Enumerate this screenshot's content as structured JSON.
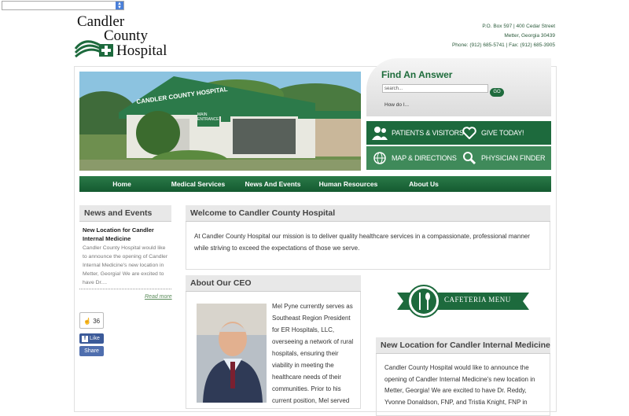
{
  "logo": {
    "line1": "Candler",
    "line2": "County",
    "line3": "Hospital"
  },
  "contact": {
    "address": "P.O. Box 597 | 400 Cedar Street",
    "city": "Metter, Georgia 30439",
    "phone": "Phone: (912) 685-5741 | Fax: (912) 685-3905"
  },
  "hero": {
    "sign_text": "CANDLER COUNTY HOSPITAL",
    "entrance_label": "MAIN ENTRANCE"
  },
  "find_answer": {
    "title": "Find An Answer",
    "search_value": "search...",
    "go_label": "GO",
    "howdo_label": "How do I..."
  },
  "quick_links": [
    {
      "label": "PATIENTS & VISITORS",
      "icon": "people-icon"
    },
    {
      "label": "GIVE TODAY!",
      "icon": "heart-icon"
    },
    {
      "label": "MAP & DIRECTIONS",
      "icon": "globe-icon"
    },
    {
      "label": "PHYSICIAN FINDER",
      "icon": "magnifier-icon"
    }
  ],
  "nav": [
    "Home",
    "Medical Services",
    "News And Events",
    "Human Resources",
    "About Us"
  ],
  "news": {
    "header": "News and Events",
    "title": "New Location for Candler Internal Medicine",
    "body": "Candler County Hospital would like to announce the opening of Candler Internal Medicine's new location in Metter, Georgia! We are excited to have Dr....",
    "read_more": "Read more"
  },
  "social": {
    "like_count": "36",
    "like_label": "Like",
    "share_label": "Share"
  },
  "welcome": {
    "header": "Welcome to Candler County Hospital",
    "text": "At Candler County Hospital our mission is to deliver quality healthcare services in a compassionate, professional manner while striving to exceed the expectations of those we serve."
  },
  "ceo": {
    "header": "About Our CEO",
    "text": "Mel Pyne currently serves as Southeast Region President for ER Hospitals, LLC, overseeing a network of rural hospitals, ensuring their viability in meeting the healthcare needs of their communities. Prior to his current position, Mel served"
  },
  "cafeteria": {
    "label": "CAFETERIA MENU"
  },
  "location": {
    "header": "New Location for Candler Internal Medicine",
    "text": "Candler County Hospital would like to announce the opening of Candler Internal Medicine's new location in Metter, Georgia! We are excited to have Dr. Reddy, Yvonne Donaldson, FNP, and Tristia Knight, FNP in"
  },
  "colors": {
    "brand_green": "#1d6a3d",
    "light_green": "#3f8a5a",
    "link_green": "#5b8c5b"
  }
}
